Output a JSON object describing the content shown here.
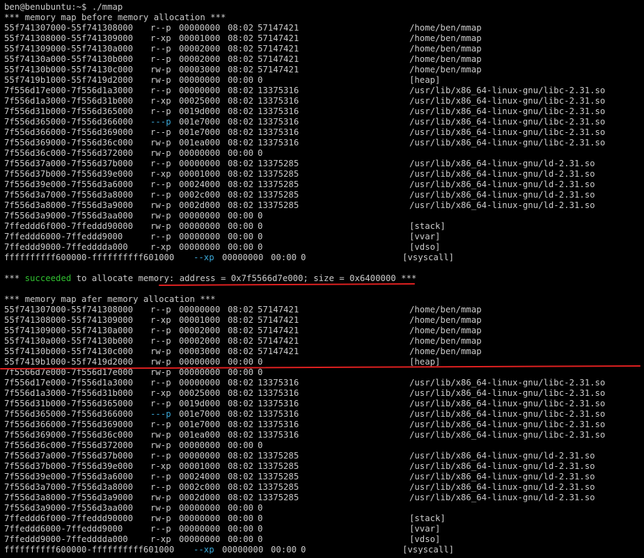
{
  "prompt": "ben@benubuntu:~$ ./mmap",
  "before_header": "*** memory map before memory allocation ***",
  "before_rows": [
    {
      "addr": "55f741307000-55f741308000",
      "perm": "r--p",
      "off": "00000000",
      "dev": "08:02",
      "inode": "57147421",
      "path": "/home/ben/mmap"
    },
    {
      "addr": "55f741308000-55f741309000",
      "perm": "r-xp",
      "off": "00001000",
      "dev": "08:02",
      "inode": "57147421",
      "path": "/home/ben/mmap"
    },
    {
      "addr": "55f741309000-55f74130a000",
      "perm": "r--p",
      "off": "00002000",
      "dev": "08:02",
      "inode": "57147421",
      "path": "/home/ben/mmap"
    },
    {
      "addr": "55f74130a000-55f74130b000",
      "perm": "r--p",
      "off": "00002000",
      "dev": "08:02",
      "inode": "57147421",
      "path": "/home/ben/mmap"
    },
    {
      "addr": "55f74130b000-55f74130c000",
      "perm": "rw-p",
      "off": "00003000",
      "dev": "08:02",
      "inode": "57147421",
      "path": "/home/ben/mmap"
    },
    {
      "addr": "55f7419b1000-55f7419d2000",
      "perm": "rw-p",
      "off": "00000000",
      "dev": "00:00",
      "inode": "0",
      "path": "[heap]"
    },
    {
      "addr": "7f556d17e000-7f556d1a3000",
      "perm": "r--p",
      "off": "00000000",
      "dev": "08:02",
      "inode": "13375316",
      "path": "/usr/lib/x86_64-linux-gnu/libc-2.31.so"
    },
    {
      "addr": "7f556d1a3000-7f556d31b000",
      "perm": "r-xp",
      "off": "00025000",
      "dev": "08:02",
      "inode": "13375316",
      "path": "/usr/lib/x86_64-linux-gnu/libc-2.31.so"
    },
    {
      "addr": "7f556d31b000-7f556d365000",
      "perm": "r--p",
      "off": "0019d000",
      "dev": "08:02",
      "inode": "13375316",
      "path": "/usr/lib/x86_64-linux-gnu/libc-2.31.so"
    },
    {
      "addr": "7f556d365000-7f556d366000",
      "perm": "---p",
      "off": "001e7000",
      "dev": "08:02",
      "inode": "13375316",
      "path": "/usr/lib/x86_64-linux-gnu/libc-2.31.so",
      "cyan_perm": true
    },
    {
      "addr": "7f556d366000-7f556d369000",
      "perm": "r--p",
      "off": "001e7000",
      "dev": "08:02",
      "inode": "13375316",
      "path": "/usr/lib/x86_64-linux-gnu/libc-2.31.so"
    },
    {
      "addr": "7f556d369000-7f556d36c000",
      "perm": "rw-p",
      "off": "001ea000",
      "dev": "08:02",
      "inode": "13375316",
      "path": "/usr/lib/x86_64-linux-gnu/libc-2.31.so"
    },
    {
      "addr": "7f556d36c000-7f556d372000",
      "perm": "rw-p",
      "off": "00000000",
      "dev": "00:00",
      "inode": "0",
      "path": ""
    },
    {
      "addr": "7f556d37a000-7f556d37b000",
      "perm": "r--p",
      "off": "00000000",
      "dev": "08:02",
      "inode": "13375285",
      "path": "/usr/lib/x86_64-linux-gnu/ld-2.31.so"
    },
    {
      "addr": "7f556d37b000-7f556d39e000",
      "perm": "r-xp",
      "off": "00001000",
      "dev": "08:02",
      "inode": "13375285",
      "path": "/usr/lib/x86_64-linux-gnu/ld-2.31.so"
    },
    {
      "addr": "7f556d39e000-7f556d3a6000",
      "perm": "r--p",
      "off": "00024000",
      "dev": "08:02",
      "inode": "13375285",
      "path": "/usr/lib/x86_64-linux-gnu/ld-2.31.so"
    },
    {
      "addr": "7f556d3a7000-7f556d3a8000",
      "perm": "r--p",
      "off": "0002c000",
      "dev": "08:02",
      "inode": "13375285",
      "path": "/usr/lib/x86_64-linux-gnu/ld-2.31.so"
    },
    {
      "addr": "7f556d3a8000-7f556d3a9000",
      "perm": "rw-p",
      "off": "0002d000",
      "dev": "08:02",
      "inode": "13375285",
      "path": "/usr/lib/x86_64-linux-gnu/ld-2.31.so"
    },
    {
      "addr": "7f556d3a9000-7f556d3aa000",
      "perm": "rw-p",
      "off": "00000000",
      "dev": "00:00",
      "inode": "0",
      "path": ""
    },
    {
      "addr": "7ffeddd6f000-7ffeddd90000",
      "perm": "rw-p",
      "off": "00000000",
      "dev": "00:00",
      "inode": "0",
      "path": "[stack]"
    },
    {
      "addr": "7ffeddd6000-7ffeddd9000",
      "perm": "r--p",
      "off": "00000000",
      "dev": "00:00",
      "inode": "0",
      "path": "[vvar]"
    },
    {
      "addr": "7ffeddd9000-7ffedddda000",
      "perm": "r-xp",
      "off": "00000000",
      "dev": "00:00",
      "inode": "0",
      "path": "[vdso]"
    },
    {
      "addr": "ffffffffff600000-ffffffffff601000",
      "perm": "--xp",
      "off": "00000000",
      "dev": "00:00",
      "inode": "0",
      "path": "[vsyscall]",
      "cyan_perm": true,
      "vsys": true
    }
  ],
  "alloc": {
    "prefix": "*** ",
    "succeeded": "succeeded",
    "middle": " to allocate memory: address = ",
    "detail": "0x7f5566d7e000; size = 0x6400000",
    "suffix": " ***"
  },
  "after_header": "*** memory map afer memory allocation ***",
  "after_rows": [
    {
      "addr": "55f741307000-55f741308000",
      "perm": "r--p",
      "off": "00000000",
      "dev": "08:02",
      "inode": "57147421",
      "path": "/home/ben/mmap"
    },
    {
      "addr": "55f741308000-55f741309000",
      "perm": "r-xp",
      "off": "00001000",
      "dev": "08:02",
      "inode": "57147421",
      "path": "/home/ben/mmap"
    },
    {
      "addr": "55f741309000-55f74130a000",
      "perm": "r--p",
      "off": "00002000",
      "dev": "08:02",
      "inode": "57147421",
      "path": "/home/ben/mmap"
    },
    {
      "addr": "55f74130a000-55f74130b000",
      "perm": "r--p",
      "off": "00002000",
      "dev": "08:02",
      "inode": "57147421",
      "path": "/home/ben/mmap"
    },
    {
      "addr": "55f74130b000-55f74130c000",
      "perm": "rw-p",
      "off": "00003000",
      "dev": "08:02",
      "inode": "57147421",
      "path": "/home/ben/mmap"
    },
    {
      "addr": "55f7419b1000-55f7419d2000",
      "perm": "rw-p",
      "off": "00000000",
      "dev": "00:00",
      "inode": "0",
      "path": "[heap]"
    },
    {
      "addr": "7f5566d7e000-7f556d17e000",
      "perm": "rw-p",
      "off": "00000000",
      "dev": "00:00",
      "inode": "0",
      "path": "",
      "highlight": true
    },
    {
      "addr": "7f556d17e000-7f556d1a3000",
      "perm": "r--p",
      "off": "00000000",
      "dev": "08:02",
      "inode": "13375316",
      "path": "/usr/lib/x86_64-linux-gnu/libc-2.31.so"
    },
    {
      "addr": "7f556d1a3000-7f556d31b000",
      "perm": "r-xp",
      "off": "00025000",
      "dev": "08:02",
      "inode": "13375316",
      "path": "/usr/lib/x86_64-linux-gnu/libc-2.31.so"
    },
    {
      "addr": "7f556d31b000-7f556d365000",
      "perm": "r--p",
      "off": "0019d000",
      "dev": "08:02",
      "inode": "13375316",
      "path": "/usr/lib/x86_64-linux-gnu/libc-2.31.so"
    },
    {
      "addr": "7f556d365000-7f556d366000",
      "perm": "---p",
      "off": "001e7000",
      "dev": "08:02",
      "inode": "13375316",
      "path": "/usr/lib/x86_64-linux-gnu/libc-2.31.so",
      "cyan_perm": true
    },
    {
      "addr": "7f556d366000-7f556d369000",
      "perm": "r--p",
      "off": "001e7000",
      "dev": "08:02",
      "inode": "13375316",
      "path": "/usr/lib/x86_64-linux-gnu/libc-2.31.so"
    },
    {
      "addr": "7f556d369000-7f556d36c000",
      "perm": "rw-p",
      "off": "001ea000",
      "dev": "08:02",
      "inode": "13375316",
      "path": "/usr/lib/x86_64-linux-gnu/libc-2.31.so"
    },
    {
      "addr": "7f556d36c000-7f556d372000",
      "perm": "rw-p",
      "off": "00000000",
      "dev": "00:00",
      "inode": "0",
      "path": ""
    },
    {
      "addr": "7f556d37a000-7f556d37b000",
      "perm": "r--p",
      "off": "00000000",
      "dev": "08:02",
      "inode": "13375285",
      "path": "/usr/lib/x86_64-linux-gnu/ld-2.31.so"
    },
    {
      "addr": "7f556d37b000-7f556d39e000",
      "perm": "r-xp",
      "off": "00001000",
      "dev": "08:02",
      "inode": "13375285",
      "path": "/usr/lib/x86_64-linux-gnu/ld-2.31.so"
    },
    {
      "addr": "7f556d39e000-7f556d3a6000",
      "perm": "r--p",
      "off": "00024000",
      "dev": "08:02",
      "inode": "13375285",
      "path": "/usr/lib/x86_64-linux-gnu/ld-2.31.so"
    },
    {
      "addr": "7f556d3a7000-7f556d3a8000",
      "perm": "r--p",
      "off": "0002c000",
      "dev": "08:02",
      "inode": "13375285",
      "path": "/usr/lib/x86_64-linux-gnu/ld-2.31.so"
    },
    {
      "addr": "7f556d3a8000-7f556d3a9000",
      "perm": "rw-p",
      "off": "0002d000",
      "dev": "08:02",
      "inode": "13375285",
      "path": "/usr/lib/x86_64-linux-gnu/ld-2.31.so"
    },
    {
      "addr": "7f556d3a9000-7f556d3aa000",
      "perm": "rw-p",
      "off": "00000000",
      "dev": "00:00",
      "inode": "0",
      "path": ""
    },
    {
      "addr": "7ffeddd6f000-7ffeddd90000",
      "perm": "rw-p",
      "off": "00000000",
      "dev": "00:00",
      "inode": "0",
      "path": "[stack]"
    },
    {
      "addr": "7ffeddd6000-7ffeddd9000",
      "perm": "r--p",
      "off": "00000000",
      "dev": "00:00",
      "inode": "0",
      "path": "[vvar]"
    },
    {
      "addr": "7ffeddd9000-7ffedddda000",
      "perm": "r-xp",
      "off": "00000000",
      "dev": "00:00",
      "inode": "0",
      "path": "[vdso]"
    },
    {
      "addr": "ffffffffff600000-ffffffffff601000",
      "perm": "--xp",
      "off": "00000000",
      "dev": "00:00",
      "inode": "0",
      "path": "[vsyscall]",
      "cyan_perm": true,
      "vsys": true
    }
  ],
  "colors": {
    "background": "#000000",
    "text": "#cccccc",
    "permission_highlight": "#3ba8d8",
    "success": "#30c030",
    "annotation": "#e02020"
  }
}
